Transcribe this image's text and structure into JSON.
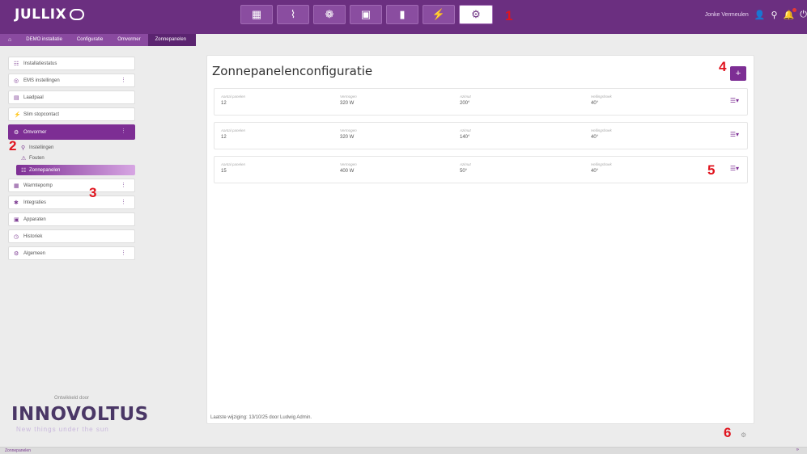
{
  "app": {
    "logo": "JULLIX"
  },
  "topbar": {
    "nav": [
      {
        "icon": "dashboard-icon",
        "glyph": "▦"
      },
      {
        "icon": "chart-icon",
        "glyph": "⌇"
      },
      {
        "icon": "brain-icon",
        "glyph": "❁"
      },
      {
        "icon": "battery-icon",
        "glyph": "▣"
      },
      {
        "icon": "device-icon",
        "glyph": "▮"
      },
      {
        "icon": "plug-icon",
        "glyph": "⚡"
      },
      {
        "icon": "gear-icon",
        "glyph": "⚙"
      }
    ],
    "user_name": "Jonke Vermeulen",
    "user_icon": "user-icon",
    "search_icon": "search-icon",
    "bell_icon": "bell-icon",
    "power_icon": "power-icon"
  },
  "breadcrumb": {
    "items": [
      "DEMO installatie",
      "Configuratie",
      "Omvormer",
      "Zonnepanelen"
    ]
  },
  "sidebar": {
    "items": [
      {
        "label": "Installatiestatus",
        "icon": "status-icon",
        "glyph": "☷",
        "has_menu": false
      },
      {
        "label": "EMS instellingen",
        "icon": "ems-icon",
        "glyph": "◎",
        "has_menu": true
      },
      {
        "label": "Laadpaal",
        "icon": "charger-icon",
        "glyph": "▤",
        "has_menu": false
      },
      {
        "label": "Slim stopcontact",
        "icon": "plug-icon",
        "glyph": "⚡",
        "has_menu": false
      }
    ],
    "active": {
      "label": "Omvormer",
      "icon": "gear-icon",
      "glyph": "⚙",
      "has_menu": true
    },
    "subitems": [
      {
        "label": "Instellingen",
        "icon": "settings-icon",
        "glyph": "⚲",
        "active": false
      },
      {
        "label": "Fouten",
        "icon": "warning-icon",
        "glyph": "⚠",
        "active": false
      },
      {
        "label": "Zonnepanelen",
        "icon": "solar-panel-icon",
        "glyph": "☷",
        "active": true
      }
    ],
    "items_after": [
      {
        "label": "Warmtepomp",
        "icon": "heatpump-icon",
        "glyph": "▦",
        "has_menu": true
      },
      {
        "label": "Integraties",
        "icon": "integration-icon",
        "glyph": "✱",
        "has_menu": true
      },
      {
        "label": "Apparaten",
        "icon": "devices-icon",
        "glyph": "▣",
        "has_menu": false
      },
      {
        "label": "Historiek",
        "icon": "history-icon",
        "glyph": "◷",
        "has_menu": false
      },
      {
        "label": "Algemeen",
        "icon": "cog-icon",
        "glyph": "⚙",
        "has_menu": true
      }
    ],
    "powered_by": "Ontwikkeld door",
    "brand": "INNOVOLTUS",
    "tagline": "New things under the sun"
  },
  "main": {
    "title": "Zonnepanelenconfiguratie",
    "add_label": "+",
    "column_labels": [
      "Aantal panelen",
      "Vermogen",
      "Azimut",
      "Hellingshoek"
    ],
    "rows": [
      {
        "count": "12",
        "power": "320 W",
        "azimuth": "200°",
        "tilt": "40°"
      },
      {
        "count": "12",
        "power": "320 W",
        "azimuth": "140°",
        "tilt": "40°"
      },
      {
        "count": "15",
        "power": "400 W",
        "azimuth": "50°",
        "tilt": "40°"
      }
    ],
    "row_menu_icon": "menu-icon",
    "footer": "Laatste wijziging: 13/10/25 door Ludwig Admin."
  },
  "markers": [
    "1",
    "2",
    "3",
    "4",
    "5",
    "6"
  ],
  "statusbar": {
    "left": "Zonnepanelen",
    "right": "»"
  }
}
